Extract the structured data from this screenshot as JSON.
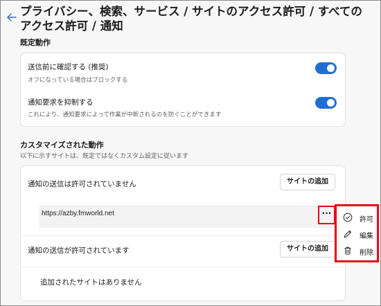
{
  "page": {
    "title": "プライバシー、検索、サービス / サイトのアクセス許可 / すべてのアクセス許可 / 通知"
  },
  "default_behavior": {
    "heading": "既定動作",
    "settings": [
      {
        "title": "送信前に確認する (推奨)",
        "description": "オフになっている場合はブロックする",
        "enabled": true
      },
      {
        "title": "通知要求を抑制する",
        "description": "これにより、通知要求によって作業が中断されるのを防ぐことができます",
        "enabled": true
      }
    ]
  },
  "customized": {
    "heading": "カスタマイズされた動作",
    "subtitle": "以下に示すサイトは、既定ではなくカスタム設定に従います",
    "block": {
      "title": "通知の送信は許可されていません",
      "add_label": "サイトの追加",
      "sites": [
        "https://azby.fmworld.net"
      ]
    },
    "allow": {
      "title": "通知の送信が許可されています",
      "add_label": "サイトの追加",
      "empty_text": "追加されたサイトはありません"
    }
  },
  "more_button": {
    "label": "···"
  },
  "context_menu": {
    "items": [
      {
        "label": "許可",
        "icon": "check-circle-icon"
      },
      {
        "label": "編集",
        "icon": "pencil-icon"
      },
      {
        "label": "削除",
        "icon": "trash-icon"
      }
    ]
  },
  "colors": {
    "accent": "#1f6fd0",
    "highlight": "#e8001a"
  }
}
